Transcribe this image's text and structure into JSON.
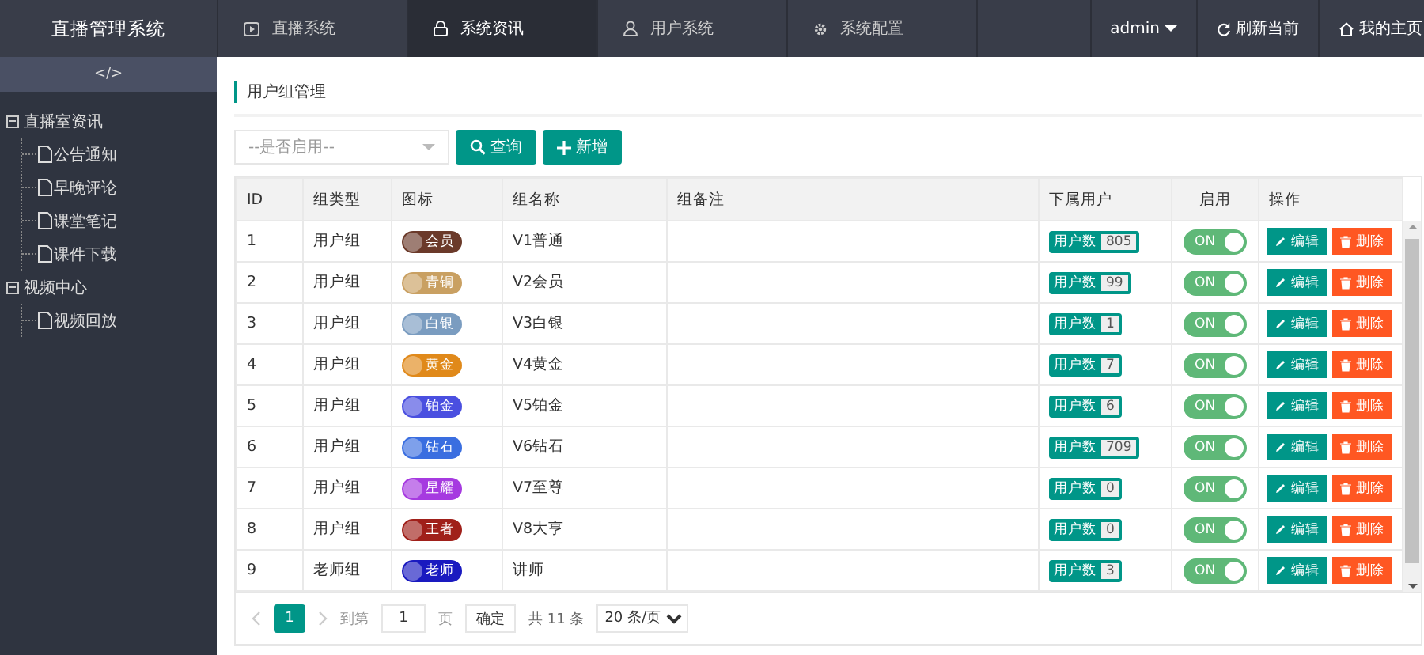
{
  "app": {
    "title": "直播管理系统"
  },
  "nav_tabs": [
    {
      "label": "直播系统",
      "selected": false
    },
    {
      "label": "系统资讯",
      "selected": true
    },
    {
      "label": "用户系统",
      "selected": false
    },
    {
      "label": "系统配置",
      "selected": false
    }
  ],
  "header_right": {
    "user": "admin",
    "refresh": "刷新当前",
    "home": "我的主页"
  },
  "sidebar": {
    "toggle": "</>",
    "tree": [
      {
        "label": "直播室资讯",
        "expanded": true,
        "children": [
          {
            "label": "公告通知"
          },
          {
            "label": "早晚评论"
          },
          {
            "label": "课堂笔记"
          },
          {
            "label": "课件下载"
          }
        ]
      },
      {
        "label": "视频中心",
        "expanded": true,
        "children": [
          {
            "label": "视频回放"
          }
        ]
      }
    ]
  },
  "page_title": "用户组管理",
  "filter": {
    "placeholder": "--是否启用--",
    "search_button": "查询",
    "add_button": "新增"
  },
  "table": {
    "columns": [
      "ID",
      "组类型",
      "图标",
      "组名称",
      "组备注",
      "下属用户",
      "启用",
      "操作"
    ],
    "rows": [
      {
        "id": "1",
        "type": "用户组",
        "badge": "会员",
        "color": "#6b3a2a",
        "name": "V1普通",
        "count_label": "用户数",
        "count": "805",
        "switch": "ON",
        "enabled": true,
        "edit": "编辑",
        "delete": "删除"
      },
      {
        "id": "2",
        "type": "用户组",
        "badge": "青铜",
        "color": "#c9a062",
        "name": "V2会员",
        "count_label": "用户数",
        "count": "99",
        "switch": "ON",
        "enabled": true,
        "edit": "编辑",
        "delete": "删除"
      },
      {
        "id": "3",
        "type": "用户组",
        "badge": "白银",
        "color": "#7a9cc0",
        "name": "V3白银",
        "count_label": "用户数",
        "count": "1",
        "switch": "ON",
        "enabled": true,
        "edit": "编辑",
        "delete": "删除"
      },
      {
        "id": "4",
        "type": "用户组",
        "badge": "黄金",
        "color": "#e0891a",
        "name": "V4黄金",
        "count_label": "用户数",
        "count": "7",
        "switch": "ON",
        "enabled": true,
        "edit": "编辑",
        "delete": "删除"
      },
      {
        "id": "5",
        "type": "用户组",
        "badge": "铂金",
        "color": "#4a4fe0",
        "name": "V5铂金",
        "count_label": "用户数",
        "count": "6",
        "switch": "ON",
        "enabled": true,
        "edit": "编辑",
        "delete": "删除"
      },
      {
        "id": "6",
        "type": "用户组",
        "badge": "钻石",
        "color": "#3a6ee0",
        "name": "V6钻石",
        "count_label": "用户数",
        "count": "709",
        "switch": "ON",
        "enabled": true,
        "edit": "编辑",
        "delete": "删除"
      },
      {
        "id": "7",
        "type": "用户组",
        "badge": "星耀",
        "color": "#a63ae0",
        "name": "V7至尊",
        "count_label": "用户数",
        "count": "0",
        "switch": "ON",
        "enabled": true,
        "edit": "编辑",
        "delete": "删除"
      },
      {
        "id": "8",
        "type": "用户组",
        "badge": "王者",
        "color": "#a0201a",
        "name": "V8大亨",
        "count_label": "用户数",
        "count": "0",
        "switch": "ON",
        "enabled": true,
        "edit": "编辑",
        "delete": "删除"
      },
      {
        "id": "9",
        "type": "老师组",
        "badge": "老师",
        "color": "#1a1ac0",
        "name": "讲师",
        "count_label": "用户数",
        "count": "3",
        "switch": "ON",
        "enabled": true,
        "edit": "编辑",
        "delete": "删除"
      }
    ]
  },
  "pagination": {
    "pages": [
      {
        "label": "1",
        "selected": true
      }
    ],
    "goto_label": "到第",
    "goto_value": "1",
    "page_unit": "页",
    "confirm": "确定",
    "total": "共 11 条",
    "page_size": "20 条/页"
  }
}
